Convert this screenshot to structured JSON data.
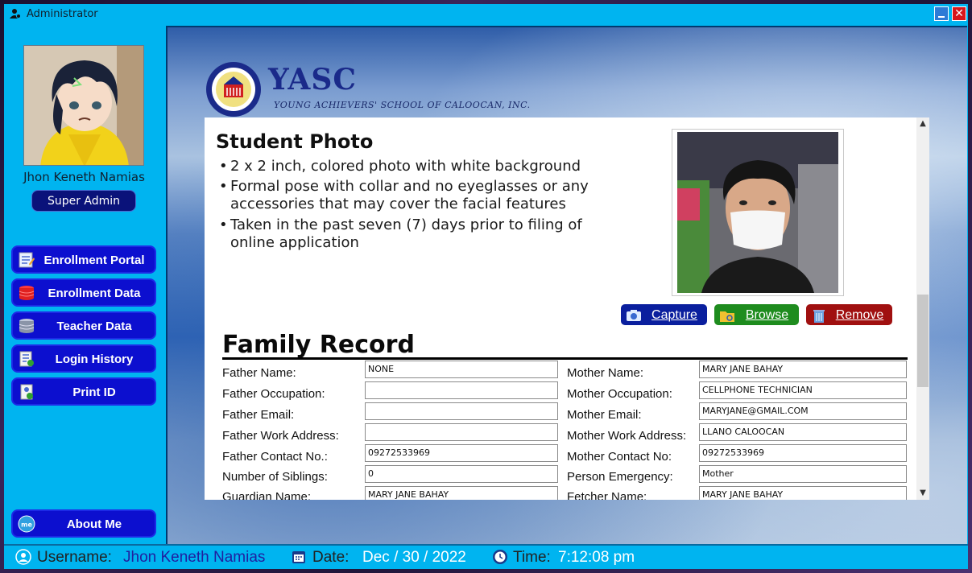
{
  "window": {
    "title": "Administrator",
    "close_glyph": "✕"
  },
  "user": {
    "name": "Jhon Keneth Namias",
    "role": "Super Admin"
  },
  "nav": [
    {
      "label": "Enrollment Portal",
      "icon": "enrollment-portal-icon"
    },
    {
      "label": "Enrollment Data",
      "icon": "database-icon"
    },
    {
      "label": "Teacher Data",
      "icon": "teacher-data-icon"
    },
    {
      "label": "Login History",
      "icon": "login-history-icon"
    },
    {
      "label": "Print ID",
      "icon": "id-card-icon"
    }
  ],
  "about": {
    "label": "About Me",
    "icon": "me-icon"
  },
  "school": {
    "name": "YASC",
    "tagline": "YOUNG ACHIEVERS' SCHOOL OF CALOOCAN, INC."
  },
  "photo_section": {
    "title": "Student Photo",
    "requirements": [
      "2 x 2 inch, colored photo with white background",
      "Formal pose with collar and no eyeglasses or any accessories that may cover the facial features",
      "Taken in the past seven (7) days prior to filing of online application"
    ],
    "buttons": {
      "capture": "Capture",
      "browse": "Browse",
      "remove": "Remove"
    }
  },
  "family": {
    "title": "Family Record",
    "left": [
      {
        "label": "Father Name:",
        "value": "NONE"
      },
      {
        "label": "Father Occupation:",
        "value": ""
      },
      {
        "label": "Father Email:",
        "value": ""
      },
      {
        "label": "Father Work Address:",
        "value": ""
      },
      {
        "label": "Father Contact No.:",
        "value": "09272533969"
      },
      {
        "label": "Number of Siblings:",
        "value": "0"
      },
      {
        "label": "Guardian Name:",
        "value": "MARY JANE BAHAY"
      }
    ],
    "right": [
      {
        "label": "Mother Name:",
        "value": "MARY JANE BAHAY"
      },
      {
        "label": "Mother Occupation:",
        "value": "CELLPHONE TECHNICIAN"
      },
      {
        "label": "Mother Email:",
        "value": "MARYJANE@GMAIL.COM"
      },
      {
        "label": "Mother Work Address:",
        "value": "LLANO CALOOCAN"
      },
      {
        "label": "Mother Contact No:",
        "value": "09272533969"
      },
      {
        "label": "Person Emergency:",
        "value": "Mother"
      },
      {
        "label": "Fetcher Name:",
        "value": "MARY JANE BAHAY"
      }
    ]
  },
  "status": {
    "username_label": "Username:",
    "username": "Jhon Keneth Namias",
    "date_label": "Date:",
    "date": "Dec / 30 / 2022",
    "time_label": "Time:",
    "time": "7:12:08 pm"
  },
  "colors": {
    "accent": "#00b4f0",
    "nav_button": "#0c0fcf",
    "capture": "#0a1f9e",
    "browse": "#1e8c1e",
    "remove": "#a01010"
  }
}
